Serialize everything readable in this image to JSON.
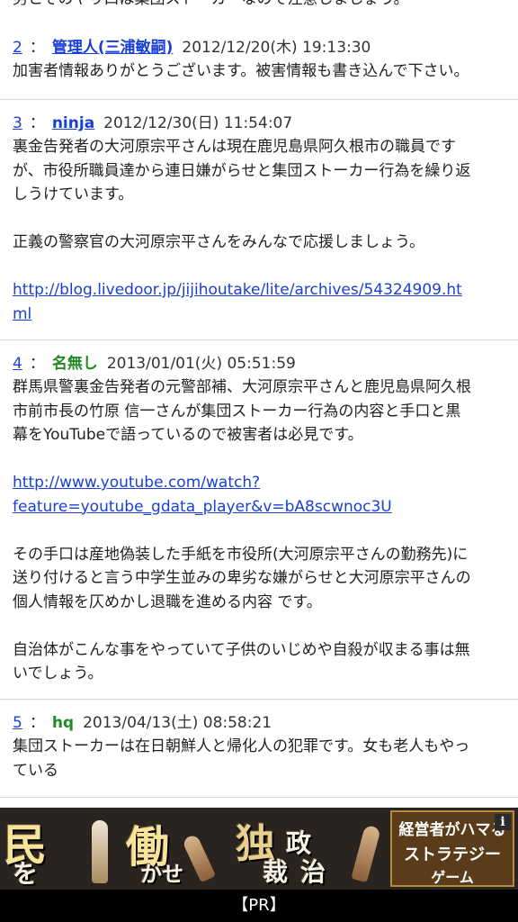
{
  "top_snippet": "男とそのやり口は集団ストーカーなので注意しましょう。",
  "posts": [
    {
      "num": "2",
      "sep": "：",
      "name": "管理人(三浦敏嗣)",
      "datetime": "2012/12/20(木) 19:13:30",
      "lines": [
        "加害者情報ありがとうございます。被害情報も書き込んで下さい。"
      ]
    },
    {
      "num": "3",
      "sep": "：",
      "name": "ninja",
      "datetime": "2012/12/30(日) 11:54:07",
      "lines": [
        "裏金告発者の大河原宗平さんは現在鹿児島県阿久根市の職員です",
        "が、市役所職員達から連日嫌がらせと集団ストーカー行為を繰り返",
        "しうけています。",
        "正義の警察官の大河原宗平さんをみんなで応援しましょう。"
      ],
      "link_line1": "http://blog.livedoor.jp/jijihoutake/lite/archives/54324909.ht",
      "link_line2": "ml"
    },
    {
      "num": "4",
      "sep": "：",
      "name": "名無し",
      "datetime": "2013/01/01(火) 05:51:59",
      "lines": [
        "群馬県警裏金告発者の元警部補、大河原宗平さんと鹿児島県阿久根",
        "市前市長の竹原 信一さんが集団ストーカー行為の内容と手口と黒",
        "幕をYouTubeで語っているので被害者は必見です。",
        "その手口は産地偽装した手紙を市役所(大河原宗平さんの勤務先)に",
        "送り付けると言う中学生並みの卑劣な嫌がらせと大河原宗平さんの",
        "個人情報を仄めかし退職を進める内容 です。",
        "自治体がこんな事をやっていて子供のいじめや自殺が収まる事は無",
        "いでしょう。"
      ],
      "link_line1": "http://www.youtube.com/watch?",
      "link_line2": "feature=youtube_gdata_player&v=bA8scwnoc3U"
    },
    {
      "num": "5",
      "sep": "：",
      "name": "hq",
      "datetime": "2013/04/13(土) 08:58:21",
      "lines": [
        "集団ストーカーは在日朝鮮人と帰化人の犯罪です。女も老人もやっ",
        "ている"
      ]
    }
  ],
  "ad": {
    "char_min": "民",
    "char_wo": "を",
    "char_hataraku": "働",
    "char_kase": "かせ",
    "char_doku": "独",
    "char_sei": "政",
    "char_sai": "裁",
    "char_ji": "治",
    "box_line1": "経営者がハマる",
    "box_line2": "ストラテジー",
    "box_line3": "ゲーム",
    "info": "i",
    "footer": "【PR】"
  },
  "colors": {
    "link": "#1a3fd6",
    "plain_name": "#218a21",
    "divider": "#d4d4d4",
    "ad_footer": "#000000"
  }
}
